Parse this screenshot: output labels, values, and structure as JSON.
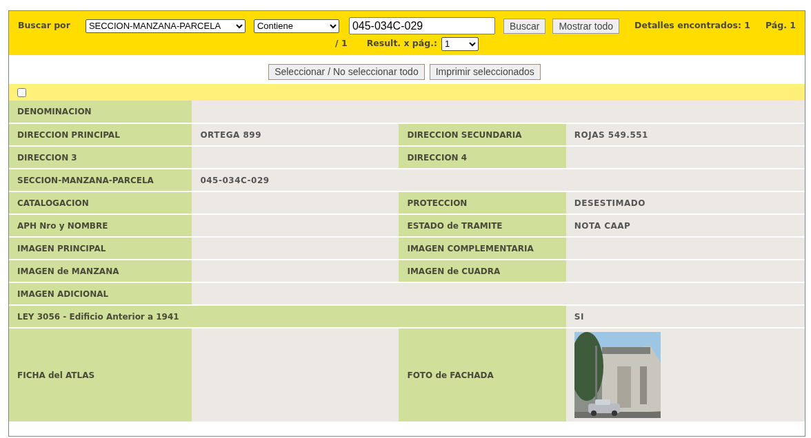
{
  "search": {
    "label": "Buscar por",
    "field": "SECCION-MANZANA-PARCELA",
    "operator": "Contiene",
    "value": "045-034C-029",
    "search_button": "Buscar",
    "show_all_button": "Mostrar todo",
    "found": "Detalles encontrados: 1",
    "page": "Pág. 1",
    "page_total": "/ 1",
    "per_page_label": "Result. x pág.:",
    "per_page": "1"
  },
  "actions": [
    "Seleccionar / No seleccionar todo",
    "Imprimir seleccionados"
  ],
  "record": {
    "checked": false,
    "rows": [
      [
        {
          "kind": "label",
          "text": "DENOMINACION"
        },
        {
          "kind": "value"
        },
        {
          "kind": "value"
        },
        {
          "kind": "value"
        }
      ],
      [
        {
          "kind": "label",
          "text": "DIRECCION PRINCIPAL"
        },
        {
          "kind": "value",
          "text": "ORTEGA 899"
        },
        {
          "kind": "label",
          "text": "DIRECCION SECUNDARIA"
        },
        {
          "kind": "value",
          "text": "ROJAS 549.551"
        }
      ],
      [
        {
          "kind": "label",
          "text": "DIRECCION 3"
        },
        {
          "kind": "value"
        },
        {
          "kind": "label",
          "text": "DIRECCION 4"
        },
        {
          "kind": "value"
        }
      ],
      [
        {
          "kind": "label",
          "text": "SECCION-MANZANA-PARCELA"
        },
        {
          "kind": "value",
          "text": "045-034C-029"
        },
        {
          "kind": "value"
        },
        {
          "kind": "value"
        }
      ],
      [
        {
          "kind": "label",
          "text": "CATALOGACION"
        },
        {
          "kind": "value"
        },
        {
          "kind": "label",
          "text": "PROTECCION"
        },
        {
          "kind": "value",
          "text": "DESESTIMADO"
        }
      ],
      [
        {
          "kind": "label",
          "text": "APH Nro y NOMBRE"
        },
        {
          "kind": "value"
        },
        {
          "kind": "label",
          "text": "ESTADO de TRAMITE"
        },
        {
          "kind": "value",
          "text": "NOTA CAAP"
        }
      ],
      [
        {
          "kind": "label",
          "text": "IMAGEN PRINCIPAL"
        },
        {
          "kind": "value"
        },
        {
          "kind": "label",
          "text": "IMAGEN COMPLEMENTARIA"
        },
        {
          "kind": "value"
        }
      ],
      [
        {
          "kind": "label",
          "text": "IMAGEN de MANZANA"
        },
        {
          "kind": "value"
        },
        {
          "kind": "label",
          "text": "IMAGEN de CUADRA"
        },
        {
          "kind": "value"
        }
      ],
      [
        {
          "kind": "label",
          "text": "IMAGEN ADICIONAL"
        },
        {
          "kind": "value"
        },
        {
          "kind": "value"
        },
        {
          "kind": "value"
        }
      ],
      [
        {
          "kind": "label",
          "text": "LEY 3056 - Edificio Anterior a 1941"
        },
        {
          "kind": "label"
        },
        {
          "kind": "label"
        },
        {
          "kind": "value",
          "text": "SI"
        }
      ],
      [
        {
          "kind": "label",
          "text": "FICHA del ATLAS"
        },
        {
          "kind": "value"
        },
        {
          "kind": "label",
          "text": "FOTO de FACHADA"
        },
        {
          "kind": "picture"
        }
      ]
    ]
  }
}
